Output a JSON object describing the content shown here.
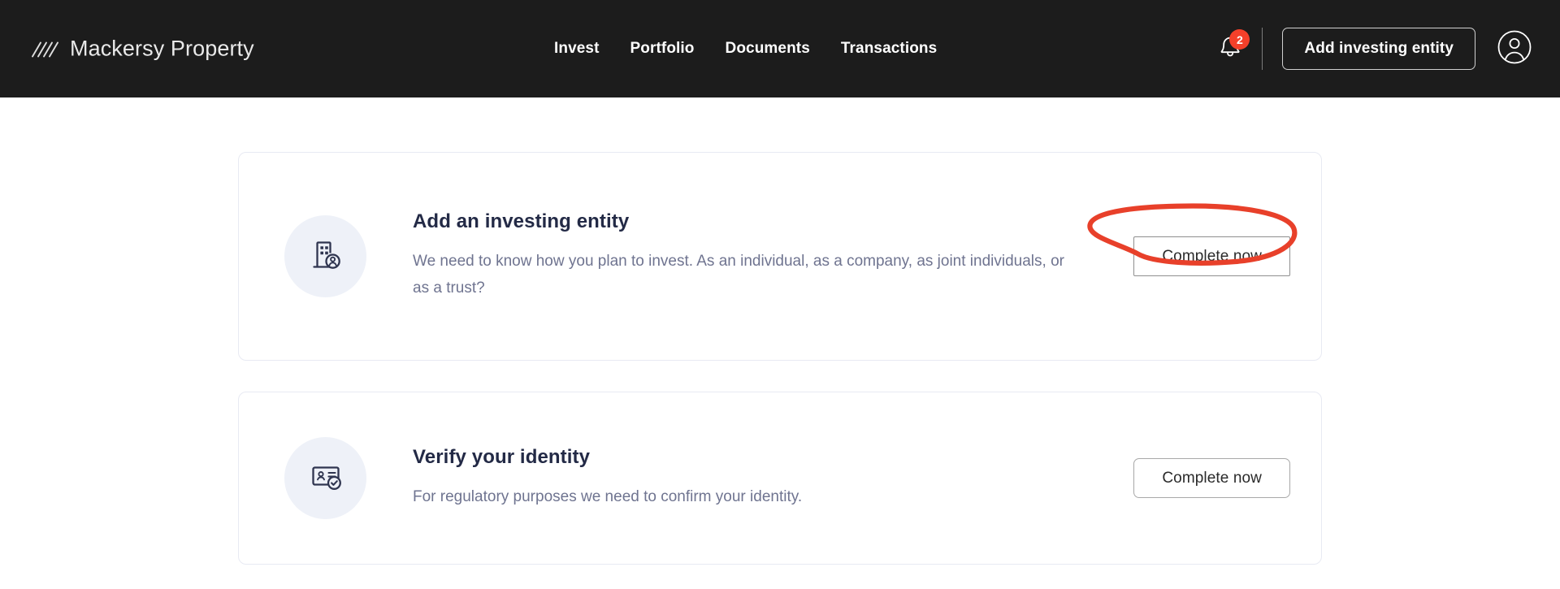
{
  "header": {
    "brand": {
      "name": "Mackersy Property",
      "logo_icon": "diagonal-slashes-logo"
    },
    "nav": [
      {
        "label": "Invest"
      },
      {
        "label": "Portfolio"
      },
      {
        "label": "Documents"
      },
      {
        "label": "Transactions"
      }
    ],
    "notifications": {
      "icon": "bell-icon",
      "count": "2",
      "badge_color": "#f4402a"
    },
    "add_entity_label": "Add investing entity",
    "account": {
      "icon": "user-circle-icon"
    },
    "background_color": "#1c1c1c"
  },
  "main": {
    "cards": [
      {
        "icon": "building-person-icon",
        "title": "Add an investing entity",
        "description": "We need to know how you plan to invest. As an individual, as a company, as joint individuals, or as a trust?",
        "action_label": "Complete now",
        "annotated": true
      },
      {
        "icon": "id-card-check-icon",
        "title": "Verify your identity",
        "description": "For regulatory purposes we need to confirm your identity.",
        "action_label": "Complete now",
        "annotated": false
      }
    ]
  },
  "annotation": {
    "shape": "ellipse",
    "color": "#e8402a",
    "target": "complete-now-button-card-1"
  }
}
